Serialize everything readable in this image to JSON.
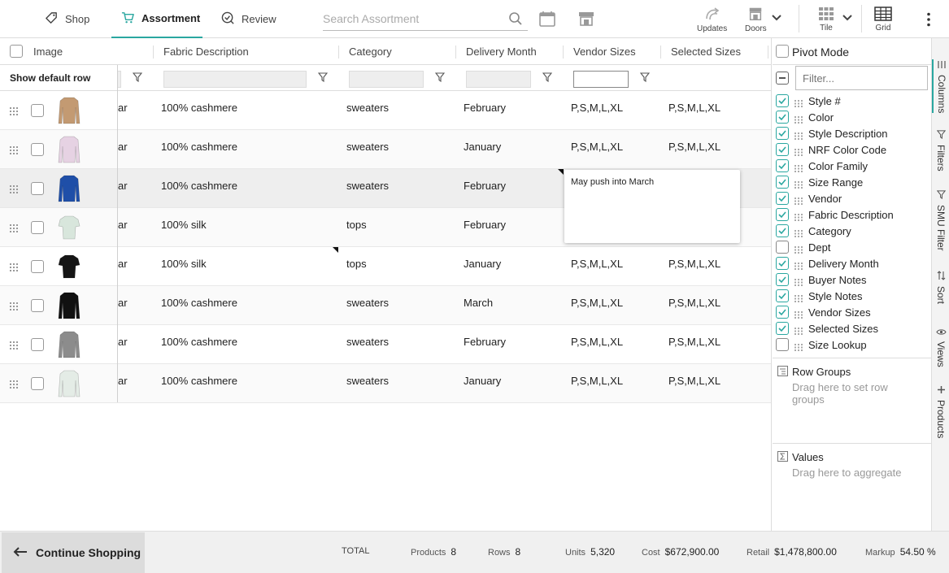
{
  "nav": {
    "shop": "Shop",
    "assortment": "Assortment",
    "review": "Review",
    "search_placeholder": "Search Assortment",
    "updates": "Updates",
    "doors": "Doors",
    "tile": "Tile",
    "grid": "Grid",
    "accent_color": "#2aa7a0"
  },
  "grid": {
    "headers": {
      "image": "Image",
      "fabric": "Fabric Description",
      "category": "Category",
      "delivery": "Delivery Month",
      "vendor_sizes": "Vendor Sizes",
      "selected_sizes": "Selected Sizes"
    },
    "show_default_row": "Show default row",
    "rows": [
      {
        "clip": "ar",
        "fabric": "100% cashmere",
        "category": "sweaters",
        "delivery": "February",
        "vendor_sizes": "P,S,M,L,XL",
        "selected_sizes": "P,S,M,L,XL",
        "color": "#c39a72",
        "shape": "long"
      },
      {
        "clip": "ar",
        "fabric": "100% cashmere",
        "category": "sweaters",
        "delivery": "January",
        "vendor_sizes": "P,S,M,L,XL",
        "selected_sizes": "P,S,M,L,XL",
        "color": "#e6d2e3",
        "shape": "long"
      },
      {
        "clip": "ar",
        "fabric": "100% cashmere",
        "category": "sweaters",
        "delivery": "February",
        "vendor_sizes": "",
        "selected_sizes": "",
        "color": "#1f4fa8",
        "shape": "long"
      },
      {
        "clip": "ar",
        "fabric": "100% silk",
        "category": "tops",
        "delivery": "February",
        "vendor_sizes": "",
        "selected_sizes": "",
        "color": "#d8e6dc",
        "shape": "tee"
      },
      {
        "clip": "ar",
        "fabric": "100% silk",
        "category": "tops",
        "delivery": "January",
        "vendor_sizes": "P,S,M,L,XL",
        "selected_sizes": "P,S,M,L,XL",
        "color": "#151515",
        "shape": "tee"
      },
      {
        "clip": "ar",
        "fabric": "100% cashmere",
        "category": "sweaters",
        "delivery": "March",
        "vendor_sizes": "P,S,M,L,XL",
        "selected_sizes": "P,S,M,L,XL",
        "color": "#111111",
        "shape": "long"
      },
      {
        "clip": "ar",
        "fabric": "100% cashmere",
        "category": "sweaters",
        "delivery": "February",
        "vendor_sizes": "P,S,M,L,XL",
        "selected_sizes": "P,S,M,L,XL",
        "color": "#8c8c8c",
        "shape": "long"
      },
      {
        "clip": "ar",
        "fabric": "100% cashmere",
        "category": "sweaters",
        "delivery": "January",
        "vendor_sizes": "P,S,M,L,XL",
        "selected_sizes": "P,S,M,L,XL",
        "color": "#e4ece6",
        "shape": "long"
      }
    ],
    "tooltip": "May push into March"
  },
  "panel": {
    "pivot_mode": "Pivot Mode",
    "filter_placeholder": "Filter...",
    "columns": [
      {
        "label": "Style #",
        "checked": true
      },
      {
        "label": "Color",
        "checked": true
      },
      {
        "label": "Style Description",
        "checked": true
      },
      {
        "label": "NRF Color Code",
        "checked": true
      },
      {
        "label": "Color Family",
        "checked": true
      },
      {
        "label": "Size Range",
        "checked": true
      },
      {
        "label": "Vendor",
        "checked": true
      },
      {
        "label": "Fabric Description",
        "checked": true
      },
      {
        "label": "Category",
        "checked": true
      },
      {
        "label": "Dept",
        "checked": false
      },
      {
        "label": "Delivery Month",
        "checked": true
      },
      {
        "label": "Buyer Notes",
        "checked": true
      },
      {
        "label": "Style Notes",
        "checked": true
      },
      {
        "label": "Vendor Sizes",
        "checked": true
      },
      {
        "label": "Selected Sizes",
        "checked": true
      },
      {
        "label": "Size Lookup",
        "checked": false
      }
    ],
    "row_groups": "Row Groups",
    "row_groups_hint": "Drag here to set row groups",
    "values": "Values",
    "values_hint": "Drag here to aggregate"
  },
  "side_tabs": [
    "Columns",
    "Filters",
    "SMU Filter",
    "Sort",
    "Views",
    "Products"
  ],
  "footer": {
    "continue": "Continue Shopping",
    "total": "TOTAL",
    "products_label": "Products",
    "products": "8",
    "rows_label": "Rows",
    "rows": "8",
    "units_label": "Units",
    "units": "5,320",
    "cost_label": "Cost",
    "cost": "$672,900.00",
    "retail_label": "Retail",
    "retail": "$1,478,800.00",
    "markup_label": "Markup",
    "markup": "54.50 %"
  }
}
